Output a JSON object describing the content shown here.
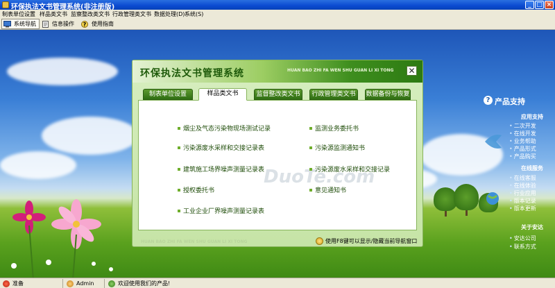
{
  "window": {
    "title": "环保执法文书管理系统(非注册版)",
    "minimize": "_",
    "maximize": "□",
    "close": "×"
  },
  "menu": [
    "制表单位设置",
    "样品类文书",
    "监察整改类文书",
    "行政管理类文书",
    "数据处理(D)",
    "系统(S)"
  ],
  "toolbar": [
    {
      "label": "系统导航",
      "icon": "monitor-icon"
    },
    {
      "label": "信息操作",
      "icon": "document-icon"
    },
    {
      "label": "使用指南",
      "icon": "help-icon"
    }
  ],
  "dialog": {
    "title": "环保执法文书管理系统",
    "pinyin": "HUAN BAO ZHI FA WEN SHU GUAN LI XI TONG",
    "close": "✕",
    "tabs": [
      "制表单位设置",
      "样品类文书",
      "监督整改类文书",
      "行政管理类文书",
      "数据备份与恢复"
    ],
    "selected_tab": "样品类文书",
    "items_left": [
      "烟尘及气态污染物现场测试记录",
      "污染源废水采样和交接记录表",
      "建筑施工场界噪声测量记录表",
      "授权委托书",
      "工业企业厂界噪声测量记录表"
    ],
    "items_right": [
      "监测业务委托书",
      "污染源监测通知书",
      "污染源废水采样和交接记录",
      "意见通知书"
    ],
    "watermark": "DuoTe.com",
    "footer_pinyin": "HUAN BAO ZHI FA WEN SHU GUAN LI XI TONG",
    "footer_hint": "使用F8键可以显示/隐藏当前导航窗口"
  },
  "right_nav": {
    "title": "产品支持",
    "sections": [
      {
        "heading": "应用支持",
        "links": [
          "二次开发",
          "在线开发",
          "业务帮助",
          "产品形式",
          "产品购买"
        ]
      },
      {
        "heading": "在线服务",
        "links": [
          "在线客服",
          "在线体验",
          "行业应用",
          "版本记录",
          "版本更新"
        ]
      },
      {
        "heading": "关于安达",
        "links": [
          "安达公司",
          "联系方式"
        ]
      }
    ]
  },
  "status": {
    "ready": "准备",
    "user": "Admin",
    "welcome": "欢迎使用我们的产品!"
  }
}
